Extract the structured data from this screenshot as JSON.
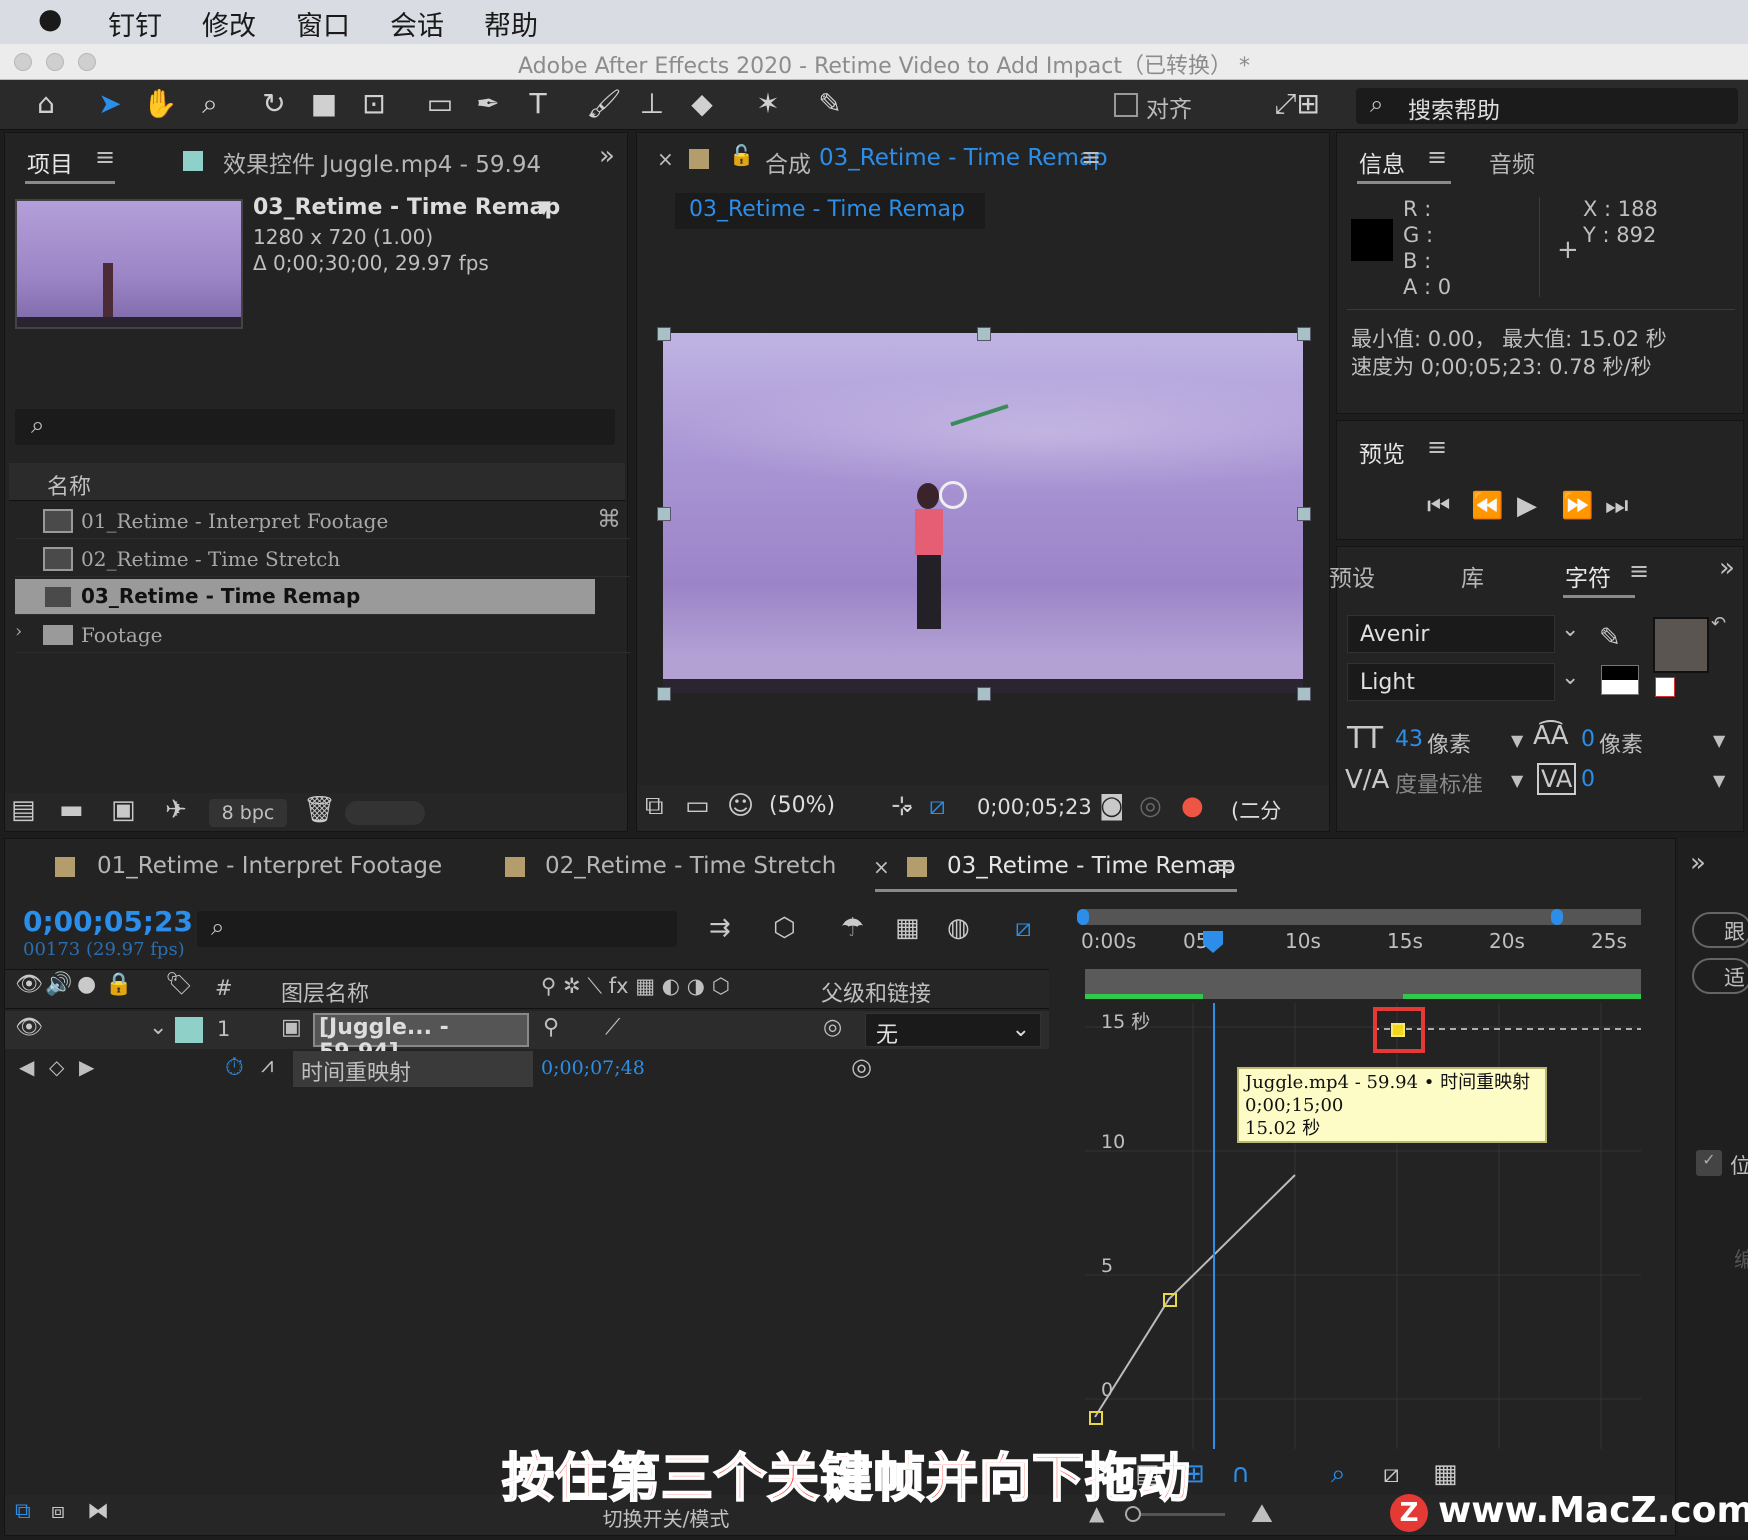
{
  "menubar": {
    "apple": "",
    "items": [
      "钉钉",
      "修改",
      "窗口",
      "会话",
      "帮助"
    ]
  },
  "window": {
    "title": "Adobe After Effects 2020 - Retime Video to Add Impact（已转换） *"
  },
  "toolbar": {
    "align_label": "对齐",
    "search_help": "搜索帮助"
  },
  "project": {
    "tab_project": "项目",
    "tab_effects": "效果控件 Juggle.mp4 - 59.94",
    "comp_name": "03_Retime - Time Remap",
    "comp_res": "1280 x 720 (1.00)",
    "comp_dur": "Δ 0;00;30;00, 29.97 fps",
    "search_placeholder": "",
    "col_name": "名称",
    "items": [
      {
        "label": "01_Retime - Interpret Footage"
      },
      {
        "label": "02_Retime - Time Stretch"
      },
      {
        "label": "03_Retime - Time Remap"
      },
      {
        "label": "Footage"
      }
    ],
    "bpc": "8 bpc"
  },
  "composition": {
    "tab_label": "合成",
    "tab_name": "03_Retime - Time Remap",
    "subtab": "03_Retime - Time Remap",
    "zoom": "(50%)",
    "timecode": "0;00;05;23",
    "more": "(二分"
  },
  "info": {
    "tab_info": "信息",
    "tab_audio": "音频",
    "r": "R :",
    "g": "G :",
    "b": "B :",
    "a": "A :  0",
    "x": "X : 188",
    "y": "Y : 892",
    "line1": "最小值: 0.00，  最大值: 15.02 秒",
    "line2": "速度为 0;00;05;23: 0.78 秒/秒"
  },
  "preview": {
    "title": "预览"
  },
  "character": {
    "tab_presets": "预设",
    "tab_library": "库",
    "tab_character": "字符",
    "font": "Avenir",
    "style": "Light",
    "size_val": "43",
    "size_unit": "像素",
    "leading_val": "0",
    "leading_unit": "像素",
    "kerning": "度量标准",
    "tracking_val": "0"
  },
  "timeline": {
    "tabs": [
      "01_Retime - Interpret Footage",
      "02_Retime - Time Stretch",
      "03_Retime - Time Remap"
    ],
    "timecode": "0;00;05;23",
    "frames": "00173 (29.97 fps)",
    "col_hash": "#",
    "col_layer": "图层名称",
    "col_parent": "父级和链接",
    "layer_num": "1",
    "layer_name": "[Juggle... - 59.94]",
    "parent_val": "无",
    "prop_name": "时间重映射",
    "prop_val": "0;00;07;48",
    "ruler": [
      "0:00s",
      "05s",
      "10s",
      "15s",
      "20s",
      "25s"
    ],
    "graph_labels": [
      "15 秒",
      "10",
      "5",
      "0"
    ],
    "tooltip": [
      "Juggle.mp4 - 59.94 • 时间重映射",
      "0;00;15;00",
      "15.02 秒"
    ],
    "footer": "切换开关/模式",
    "side": [
      "跟",
      "适",
      "位",
      "编"
    ]
  },
  "caption": "按住第三个关键帧并向下拖动",
  "watermark": "www.MacZ.com",
  "colors": {
    "accent": "#2c8ee8",
    "keyframe": "#e6d84a",
    "highlight": "#e53935",
    "caption_fill": "#ff3b30",
    "caption_stroke": "#ffffff",
    "selection": "#5a5a5a",
    "teal_label": "#8fd1c8"
  }
}
